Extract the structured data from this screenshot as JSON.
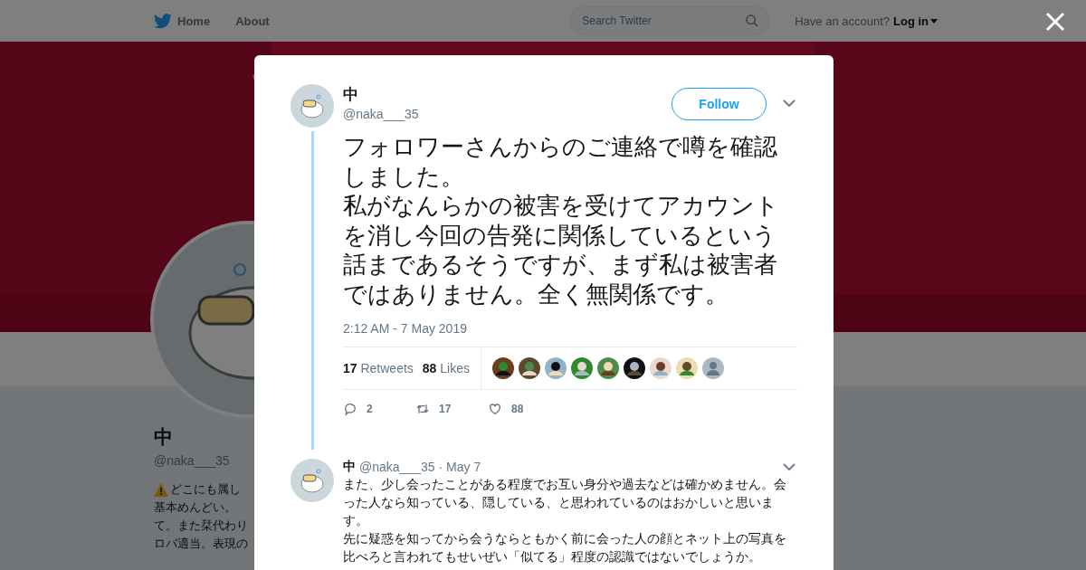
{
  "header": {
    "nav": [
      {
        "label": "Home"
      },
      {
        "label": "About"
      }
    ],
    "search": {
      "placeholder": "Search Twitter"
    },
    "account_prompt": "Have an account?",
    "login": "Log in"
  },
  "profile": {
    "name": "中",
    "handle": "@naka___35",
    "bio_lines": [
      "どこにも属し",
      "基本めんどい。",
      "て。また栞代わり",
      "ロバ適当。表現の"
    ]
  },
  "tweet": {
    "name": "中",
    "handle": "@naka___35",
    "follow": "Follow",
    "paragraphs": [
      "フォロワーさんからのご連絡で噂を確認しました。",
      "私がなんらかの被害を受けてアカウントを消し今回の告発に関係しているという話まであるそうですが、まず私は被害者ではありません。全く無関係です。"
    ],
    "time": "2:12 AM - 7 May 2019",
    "stats": [
      {
        "count": "17",
        "label": "Retweets"
      },
      {
        "count": "88",
        "label": "Likes"
      }
    ],
    "likers": [
      {
        "kind": "picture"
      },
      {
        "kind": "picture"
      },
      {
        "kind": "picture"
      },
      {
        "kind": "picture"
      },
      {
        "kind": "picture"
      },
      {
        "kind": "picture"
      },
      {
        "kind": "picture"
      },
      {
        "kind": "picture"
      },
      {
        "kind": "default"
      }
    ],
    "actions": [
      {
        "kind": "reply",
        "count": "2"
      },
      {
        "kind": "retweet",
        "count": "17"
      },
      {
        "kind": "like",
        "count": "88"
      }
    ]
  },
  "reply": {
    "name": "中",
    "handle": "@naka___35",
    "date": "· May 7",
    "paragraphs": [
      "また、少し会ったことがある程度でお互い身分や過去などは確かめません。会った人なら知っている、隠している、と思われているのはおかしいと思います。",
      "先に疑惑を知ってから会うならともかく前に会った人の顔とネット上の写真を比べろと言われてもせいぜい「似てる」程度の認識ではないでしょうか。"
    ]
  }
}
